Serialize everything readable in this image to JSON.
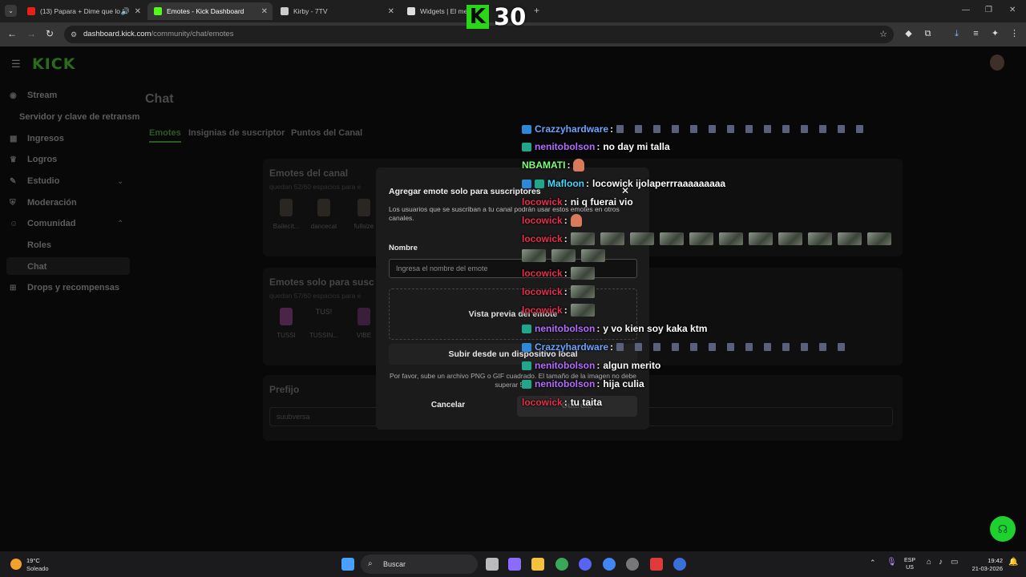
{
  "browser": {
    "tabs": [
      {
        "title": "(13) Papara + Dime que lo",
        "favicon_color": "#e62117"
      },
      {
        "title": "Emotes - Kick Dashboard",
        "favicon_color": "#53fc18"
      },
      {
        "title": "Kirby - 7TV",
        "favicon_color": "#cccccc"
      },
      {
        "title": "Widgets | El mej",
        "favicon_color": "#dddddd"
      }
    ],
    "new_tab": "+",
    "url_host": "dashboard.kick.com",
    "url_path": "/community/chat/emotes"
  },
  "overlay": {
    "badge_letter": "K",
    "count": "30"
  },
  "kick": {
    "logo": "KICK",
    "sidebar": [
      {
        "label": "Stream",
        "icon": "stream-icon"
      },
      {
        "label": "Servidor y clave de retransm",
        "icon": ""
      },
      {
        "label": "Ingresos",
        "icon": "grid-icon"
      },
      {
        "label": "Logros",
        "icon": "trophy-icon"
      },
      {
        "label": "Estudio",
        "icon": "palette-icon"
      },
      {
        "label": "Moderación",
        "icon": "shield-icon"
      },
      {
        "label": "Comunidad",
        "icon": "people-icon"
      },
      {
        "label": "Roles",
        "icon": ""
      },
      {
        "label": "Chat",
        "icon": ""
      },
      {
        "label": "Drops y recompensas",
        "icon": "gift-icon"
      }
    ],
    "page_title": "Chat",
    "tabs": [
      "Emotes",
      "Insignias de suscriptor",
      "Puntos del Canal"
    ],
    "channel_emotes": {
      "title": "Emotes del canal",
      "subtitle": "quedan 52/60 espacios para e",
      "emotes": [
        "Bailecit...",
        "dancecat",
        "fullsize"
      ]
    },
    "sub_emotes": {
      "title": "Emotes solo para susc",
      "subtitle": "quedan 57/60 espacios para e",
      "emotes": [
        "TUSSI",
        "TUSSIN...",
        "VIBE"
      ],
      "broken_label": "TUS!"
    },
    "prefix": {
      "title": "Prefijo",
      "value": "suubversa"
    }
  },
  "modal": {
    "title": "Agregar emote solo para suscriptores",
    "description": "Los usuarios que se suscriban a tu canal podrán usar estos emotes en otros canales.",
    "name_label": "Nombre",
    "name_placeholder": "Ingresa el nombre del emote",
    "preview_label": "Vista previa del emote",
    "upload_label": "Subir desde un dispositivo local",
    "upload_note": "Por favor, sube un archivo PNG o GIF cuadrado. El tamaño de la imagen no debe superar 500",
    "cancel_label": "Cancelar",
    "save_label": "Guardar"
  },
  "chat": [
    {
      "user": "Crazzyhardware",
      "color": "#6aa6ff",
      "badge": "blue",
      "text": "",
      "emotes": "small",
      "count": 14
    },
    {
      "user": "nenitobolson",
      "color": "#b36cff",
      "badge": "teal",
      "text": "no day mi talla"
    },
    {
      "user": "NBAMATI",
      "color": "#7dff7a",
      "badge": "",
      "text": "",
      "emotes": "face",
      "count": 1
    },
    {
      "user": "Mafloon",
      "color": "#47d7ff",
      "badge": "blue-teal",
      "text": "locowick ijolaperrraaaaaaaaa"
    },
    {
      "user": "locowick",
      "color": "#e52f4d",
      "badge": "",
      "text": "ni q fuerai vio"
    },
    {
      "user": "locowick",
      "color": "#e52f4d",
      "badge": "",
      "text": "",
      "emotes": "face",
      "count": 1
    },
    {
      "user": "locowick",
      "color": "#e52f4d",
      "badge": "",
      "text": "",
      "emotes": "large",
      "count": 11
    },
    {
      "user": "",
      "color": "",
      "badge": "",
      "text": "",
      "emotes": "large",
      "count": 3
    },
    {
      "user": "locowick",
      "color": "#e52f4d",
      "badge": "",
      "text": "",
      "emotes": "large",
      "count": 1
    },
    {
      "user": "locowick",
      "color": "#e52f4d",
      "badge": "",
      "text": "",
      "emotes": "large",
      "count": 1
    },
    {
      "user": "locowick",
      "color": "#e52f4d",
      "badge": "",
      "text": "",
      "emotes": "large",
      "count": 1
    },
    {
      "user": "nenitobolson",
      "color": "#b36cff",
      "badge": "teal",
      "text": "y vo kien soy kaka ktm"
    },
    {
      "user": "Crazzyhardware",
      "color": "#6aa6ff",
      "badge": "blue",
      "text": "",
      "emotes": "small",
      "count": 13
    },
    {
      "user": "nenitobolson",
      "color": "#b36cff",
      "badge": "teal",
      "text": "algun merito"
    },
    {
      "user": "nenitobolson",
      "color": "#b36cff",
      "badge": "teal",
      "text": "hija culia"
    },
    {
      "user": "locowick",
      "color": "#e52f4d",
      "badge": "",
      "text": "tu taita"
    }
  ],
  "taskbar": {
    "temp": "19°C",
    "weather": "Soleado",
    "search": "Buscar",
    "lang_1": "ESP",
    "lang_2": "US",
    "time": "19:42",
    "date": "21-03-2026"
  }
}
